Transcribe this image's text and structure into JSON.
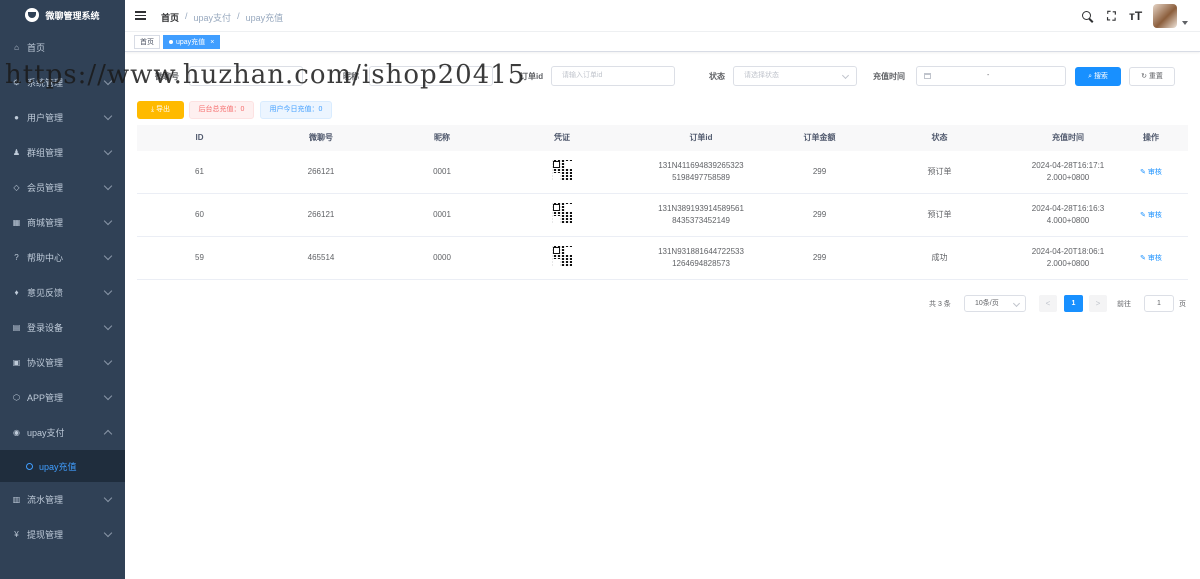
{
  "app": {
    "logo_text": "微聊管理系统"
  },
  "sidebar": {
    "items": [
      {
        "label": "首页",
        "icon": "home-icon",
        "glyph": "⌂",
        "has_children": false
      },
      {
        "label": "系统管理",
        "icon": "gear-icon",
        "glyph": "⚙",
        "has_children": true
      },
      {
        "label": "用户管理",
        "icon": "user-icon",
        "glyph": "●",
        "has_children": true
      },
      {
        "label": "群组管理",
        "icon": "group-icon",
        "glyph": "♟",
        "has_children": true
      },
      {
        "label": "会员管理",
        "icon": "member-icon",
        "glyph": "◇",
        "has_children": true
      },
      {
        "label": "商城管理",
        "icon": "cart-icon",
        "glyph": "▦",
        "has_children": true
      },
      {
        "label": "帮助中心",
        "icon": "help-icon",
        "glyph": "?",
        "has_children": true
      },
      {
        "label": "意见反馈",
        "icon": "feedback-icon",
        "glyph": "♦",
        "has_children": true
      },
      {
        "label": "登录设备",
        "icon": "device-icon",
        "glyph": "▤",
        "has_children": true
      },
      {
        "label": "协议管理",
        "icon": "document-icon",
        "glyph": "▣",
        "has_children": true
      },
      {
        "label": "APP管理",
        "icon": "app-icon",
        "glyph": "⬡",
        "has_children": true
      },
      {
        "label": "upay支付",
        "icon": "pay-icon",
        "glyph": "◉",
        "has_children": true,
        "expanded": true
      }
    ],
    "sub_item": {
      "label": "upay充值"
    },
    "items_after": [
      {
        "label": "流水管理",
        "icon": "ledger-icon",
        "glyph": "▥",
        "has_children": true
      },
      {
        "label": "提现管理",
        "icon": "yen-icon",
        "glyph": "¥",
        "has_children": true
      }
    ]
  },
  "navbar": {
    "breadcrumb": [
      "首页",
      "/",
      "upay支付",
      "/",
      "upay充值"
    ],
    "size_glyph": "тT"
  },
  "tags": [
    {
      "label": "首页",
      "active": false
    },
    {
      "label": "upay充值",
      "active": true,
      "close": "×"
    }
  ],
  "watermark": "https://www.huzhan.com/ishop20415",
  "filters": {
    "wechat_label": "微聊号",
    "nickname_label": "昵称",
    "order_label": "订单id",
    "order_placeholder": "请输入订单id",
    "status_label": "状态",
    "status_placeholder": "请选择状态",
    "time_label": "充值时间",
    "time_separator": "-",
    "search_button": "搜索",
    "reset_button": "重置"
  },
  "toolbar": {
    "export_label": "导出",
    "backend_total": "后台总充值：0",
    "today_total": "用户今日充值：0"
  },
  "table": {
    "headers": [
      "ID",
      "微聊号",
      "昵称",
      "凭证",
      "订单id",
      "订单金额",
      "状态",
      "充值时间",
      "操作"
    ],
    "rows": [
      {
        "id": "61",
        "wechat": "266121",
        "nickname": "0001",
        "order_l1": "131N411694839265323",
        "order_l2": "5198497758589",
        "amount": "299",
        "status": "预订单",
        "time_l1": "2024-04-28T16:17:1",
        "time_l2": "2.000+0800",
        "action": "审核"
      },
      {
        "id": "60",
        "wechat": "266121",
        "nickname": "0001",
        "order_l1": "131N389193914589561",
        "order_l2": "8435373452149",
        "amount": "299",
        "status": "预订单",
        "time_l1": "2024-04-28T16:16:3",
        "time_l2": "4.000+0800",
        "action": "审核"
      },
      {
        "id": "59",
        "wechat": "465514",
        "nickname": "0000",
        "order_l1": "131N931881644722533",
        "order_l2": "1264694828573",
        "amount": "299",
        "status": "成功",
        "time_l1": "2024-04-20T18:06:1",
        "time_l2": "2.000+0800",
        "action": "审核"
      }
    ]
  },
  "pagination": {
    "total": "共 3 条",
    "page_size": "10条/页",
    "prev": "<",
    "current": "1",
    "next": ">",
    "goto": "前往",
    "goto_value": "1",
    "page_unit": "页"
  },
  "colors": {
    "sidebar_bg": "#304156",
    "primary": "#1890ff",
    "warning": "#ffba00"
  }
}
